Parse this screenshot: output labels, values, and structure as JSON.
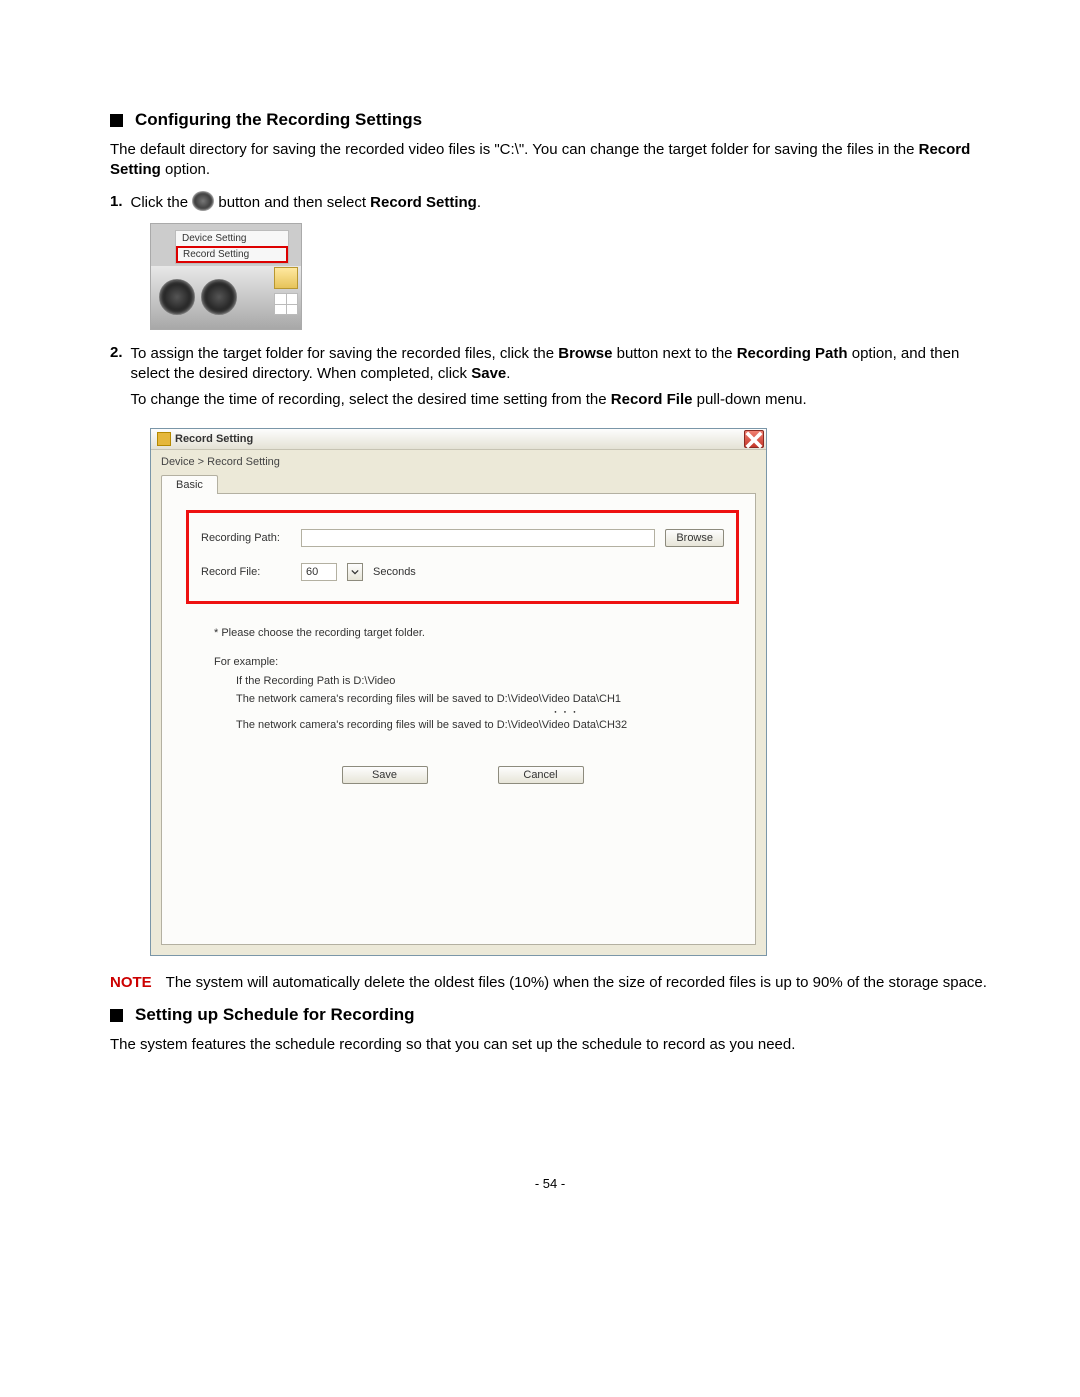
{
  "heading1": "Configuring the Recording Settings",
  "p1a": "The default directory for saving the recorded video files is \"C:\\\". You can change the target folder for saving the files in the ",
  "p1b_bold": "Record Setting",
  "p1c": " option.",
  "step1": {
    "num": "1.",
    "a": "Click the ",
    "b": " button and then select ",
    "c_bold": "Record Setting",
    "d": "."
  },
  "mini": {
    "menu1": "Device Setting",
    "menu2": "Record Setting"
  },
  "step2": {
    "num": "2.",
    "a": "To assign the target folder for saving the recorded files, click the ",
    "b_bold": "Browse",
    "c": " button next to the ",
    "d_bold": "Recording Path",
    "e": " option, and then select the desired directory. When completed, click ",
    "f_bold": "Save",
    "g": ".",
    "p2a": "To change the time of recording, select the desired time setting from the ",
    "p2b_bold": "Record File",
    "p2c": " pull-down menu."
  },
  "dialog": {
    "title": "Record Setting",
    "breadcrumb": "Device > Record Setting",
    "tab": "Basic",
    "label_path": "Recording Path:",
    "browse": "Browse",
    "label_file": "Record File:",
    "file_value": "60",
    "file_unit": "Seconds",
    "help1": "* Please choose the recording target folder.",
    "help2": "For example:",
    "help3": "If the Recording Path is D:\\Video",
    "help4": "The network camera's recording files will be saved to D:\\Video\\Video Data\\CH1",
    "help5": "The network camera's recording files will be saved to D:\\Video\\Video Data\\CH32",
    "save": "Save",
    "cancel": "Cancel"
  },
  "note": {
    "label": "NOTE",
    "text": "The system will automatically delete the oldest files (10%) when the size of recorded files is up to 90% of the storage space."
  },
  "heading2": "Setting up Schedule for Recording",
  "p3": "The system features the schedule recording so that you can set up the schedule to record as you need.",
  "pagenum": "- 54 -"
}
